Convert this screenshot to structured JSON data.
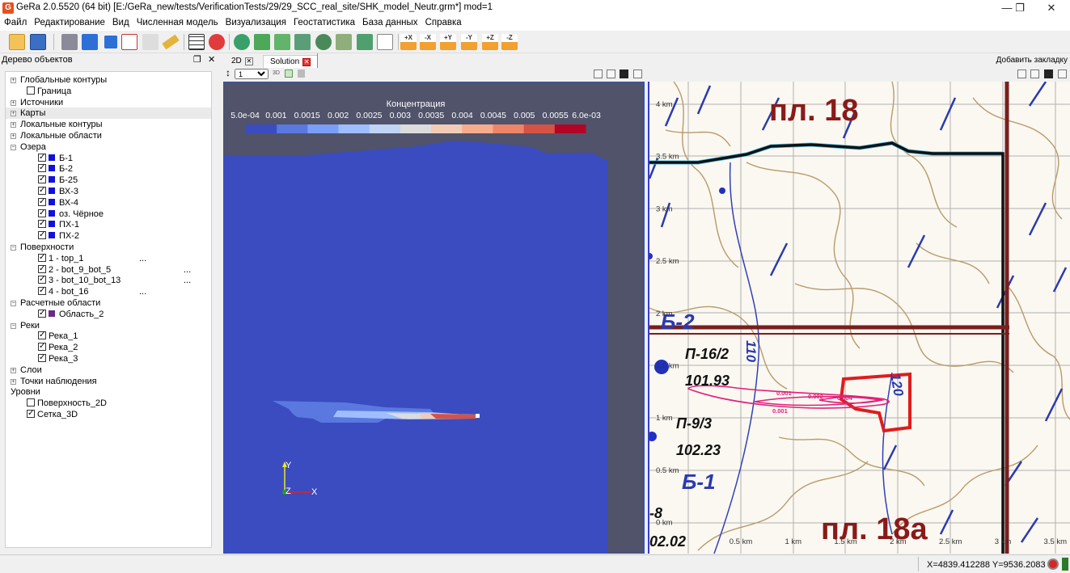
{
  "window": {
    "title": "GeRa 2.0.5520 (64 bit)  [E:/GeRa_new/tests/VerificationTests/29/29_SCC_real_site/SHK_model_Neutr.grm*] mod=1",
    "app_icon": "G",
    "controls": {
      "minimize": "—",
      "maximize": "❐",
      "close": "✕"
    }
  },
  "menu": [
    "Файл",
    "Редактирование",
    "Вид",
    "Численная модель",
    "Визуализация",
    "Геостатистика",
    "База данных",
    "Справка"
  ],
  "toolbar": {
    "items": [
      "open-folder-icon",
      "save-icon",
      "sketch-icon",
      "cube-icon",
      "cube-small-icon",
      "map-select-icon",
      "pointer-icon",
      "ruler-icon",
      "grid-icon",
      "run-icon",
      "layers-icon",
      "box1-icon",
      "box2-icon",
      "box3-icon",
      "globe-icon",
      "stack-icon",
      "fill-icon",
      "chart-icon"
    ],
    "axis_buttons": [
      "+X",
      "-X",
      "+Y",
      "-Y",
      "+Z",
      "-Z"
    ]
  },
  "object_tree": {
    "title": "Дерево объектов",
    "float_icon": "❐",
    "close_icon": "✕",
    "rows": [
      {
        "label": "Глобальные контуры",
        "level": 0,
        "expander": "+"
      },
      {
        "label": "Граница",
        "level": 1,
        "checkbox": false
      },
      {
        "label": "Источники",
        "level": 0,
        "expander": "+"
      },
      {
        "label": "Карты",
        "level": 0,
        "expander": "+",
        "selected": true
      },
      {
        "label": "Локальные контуры",
        "level": 0,
        "expander": "+"
      },
      {
        "label": "Локальные области",
        "level": 0,
        "expander": "+"
      },
      {
        "label": "Озера",
        "level": 0,
        "expander": "−"
      },
      {
        "label": "Б-1",
        "level": 2,
        "checkbox": true,
        "swatch": "#1010e0"
      },
      {
        "label": "Б-2",
        "level": 2,
        "checkbox": true,
        "swatch": "#1010e0"
      },
      {
        "label": "Б-25",
        "level": 2,
        "checkbox": true,
        "swatch": "#1010e0"
      },
      {
        "label": "ВХ-3",
        "level": 2,
        "checkbox": true,
        "swatch": "#1010e0"
      },
      {
        "label": "ВХ-4",
        "level": 2,
        "checkbox": true,
        "swatch": "#1010e0"
      },
      {
        "label": "оз. Чёрное",
        "level": 2,
        "checkbox": true,
        "swatch": "#1010e0"
      },
      {
        "label": "ПХ-1",
        "level": 2,
        "checkbox": true,
        "swatch": "#1010e0"
      },
      {
        "label": "ПХ-2",
        "level": 2,
        "checkbox": true,
        "swatch": "#1010e0"
      },
      {
        "label": "Поверхности",
        "level": 0,
        "expander": "−"
      },
      {
        "label": "1 - top_1",
        "level": 2,
        "checkbox": true,
        "dots": "...",
        "dots_pos": 1
      },
      {
        "label": "2 - bot_9_bot_5",
        "level": 2,
        "checkbox": true,
        "dots": "...",
        "dots_pos": 2
      },
      {
        "label": "3 - bot_10_bot_13",
        "level": 2,
        "checkbox": true,
        "dots": "...",
        "dots_pos": 2
      },
      {
        "label": "4 - bot_16",
        "level": 2,
        "checkbox": true,
        "dots": "...",
        "dots_pos": 1
      },
      {
        "label": "Расчетные области",
        "level": 0,
        "expander": "−"
      },
      {
        "label": "Область_2",
        "level": 2,
        "checkbox": true,
        "swatch": "#6a2a8a"
      },
      {
        "label": "Реки",
        "level": 0,
        "expander": "−"
      },
      {
        "label": "Река_1",
        "level": 2,
        "checkbox": true
      },
      {
        "label": "Река_2",
        "level": 2,
        "checkbox": true
      },
      {
        "label": "Река_3",
        "level": 2,
        "checkbox": true
      },
      {
        "label": "Слои",
        "level": 0,
        "expander": "+"
      },
      {
        "label": "Точки наблюдения",
        "level": 0,
        "expander": "+"
      },
      {
        "label": "Уровни",
        "level": 0
      },
      {
        "label": "Поверхность_2D",
        "level": 1,
        "checkbox": false
      },
      {
        "label": "Сетка_3D",
        "level": 1,
        "checkbox": true
      }
    ]
  },
  "tabs": [
    {
      "label": "2D",
      "close": "✕",
      "active": false
    },
    {
      "label": "Solution",
      "close": "✕",
      "active": true
    }
  ],
  "add_tab_label": "Добавить закладку",
  "view_toolbar": {
    "layer_value": "1",
    "mode_3d": "3D"
  },
  "solution_view": {
    "legend_title": "Концентрация",
    "legend_ticks": [
      "5.0e-04",
      "0.001",
      "0.0015",
      "0.002",
      "0.0025",
      "0.003",
      "0.0035",
      "0.004",
      "0.0045",
      "0.005",
      "0.0055",
      "6.0e-03"
    ],
    "legend_colors": [
      "#3b4cc0",
      "#5a78e0",
      "#7b9ff9",
      "#9ebeff",
      "#c0d4f5",
      "#dddcdc",
      "#f2cbb7",
      "#f7ac8e",
      "#ee8468",
      "#d65244",
      "#b40426"
    ],
    "axes": {
      "x": "X",
      "y": "Y",
      "z": "Z"
    }
  },
  "map_view": {
    "y_ticks": [
      "4 km",
      "3.5 km",
      "3 km",
      "2.5 km",
      "2 km",
      "1.5 km",
      "1 km",
      "0.5 km",
      "0 km"
    ],
    "x_ticks": [
      "0.5 km",
      "1 km",
      "1.5 km",
      "2 km",
      "2.5 km",
      "3 km",
      "3.5 km"
    ],
    "labels": {
      "pl18": "пл. 18",
      "pl18a": "пл. 18а",
      "b2": "Б-2",
      "b1": "Б-1",
      "p162": "П-16/2",
      "v10193": "101.93",
      "p93": "П-9/3",
      "v10223": "102.23",
      "n110": "110",
      "n120": "120",
      "n8": "-8",
      "v0202": "02.02"
    },
    "contour_labels": [
      "0.001",
      "0.002",
      "0.004",
      "0.001"
    ]
  },
  "status": {
    "coords": "X=4839.412288  Y=9536.2083"
  }
}
